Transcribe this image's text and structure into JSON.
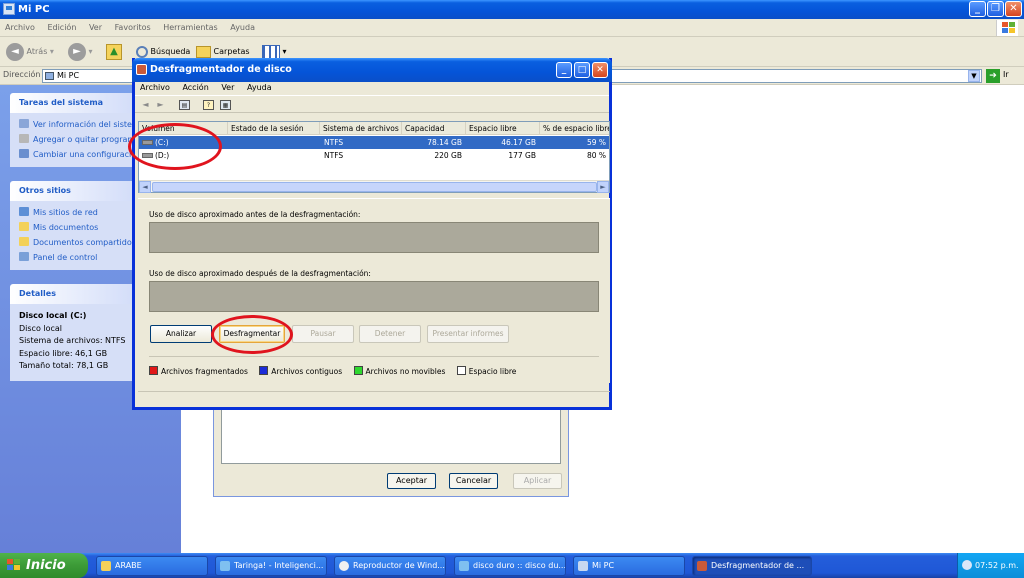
{
  "explorer": {
    "title": "Mi PC",
    "menu": [
      "Archivo",
      "Edición",
      "Ver",
      "Favoritos",
      "Herramientas",
      "Ayuda"
    ],
    "toolbar": {
      "back": "Atrás",
      "search": "Búsqueda",
      "folders": "Carpetas"
    },
    "address": {
      "label": "Dirección",
      "value": "Mi PC",
      "go": "Ir"
    },
    "tasks": {
      "title": "Tareas del sistema",
      "items": [
        "Ver información del sistema",
        "Agregar o quitar programas",
        "Cambiar una configuración"
      ]
    },
    "other_places": {
      "title": "Otros sitios",
      "items": [
        "Mis sitios de red",
        "Mis documentos",
        "Documentos compartidos",
        "Panel de control"
      ]
    },
    "details": {
      "title": "Detalles",
      "name": "Disco local (C:)",
      "type": "Disco local",
      "fs": "Sistema de archivos: NTFS",
      "free": "Espacio libre: 46,1 GB",
      "total": "Tamaño total: 78,1 GB"
    }
  },
  "properties": {
    "ok": "Aceptar",
    "cancel": "Cancelar",
    "apply": "Aplicar"
  },
  "defrag": {
    "title": "Desfragmentador de disco",
    "menu": [
      "Archivo",
      "Acción",
      "Ver",
      "Ayuda"
    ],
    "columns": [
      "Volumen",
      "Estado de la sesión",
      "Sistema de archivos",
      "Capacidad",
      "Espacio libre",
      "% de espacio libre"
    ],
    "volumes": [
      {
        "name": "(C:)",
        "status": "",
        "fs": "NTFS",
        "capacity": "78.14 GB",
        "free": "46.17 GB",
        "pct": "59 %"
      },
      {
        "name": "(D:)",
        "status": "",
        "fs": "NTFS",
        "capacity": "220 GB",
        "free": "177 GB",
        "pct": "80 %"
      }
    ],
    "before_label": "Uso de disco aproximado antes de la desfragmentación:",
    "after_label": "Uso de disco aproximado después de la desfragmentación:",
    "buttons": {
      "analyze": "Analizar",
      "defrag": "Desfragmentar",
      "pause": "Pausar",
      "stop": "Detener",
      "report": "Presentar informes"
    },
    "legend": [
      {
        "label": "Archivos fragmentados",
        "color": "#e01818"
      },
      {
        "label": "Archivos contiguos",
        "color": "#1c2cd8"
      },
      {
        "label": "Archivos no movibles",
        "color": "#2fd82f"
      },
      {
        "label": "Espacio libre",
        "color": "#ffffff"
      }
    ]
  },
  "taskbar": {
    "start": "Inicio",
    "buttons": [
      "ARABE",
      "Taringa! - Inteligenci...",
      "Reproductor de Wind...",
      "disco duro :: disco du...",
      "Mi PC",
      "Desfragmentador de ..."
    ],
    "clock": "07:52 p.m."
  },
  "colors": {
    "xp_blue": "#0554d8",
    "annotation_red": "#e0141e"
  }
}
